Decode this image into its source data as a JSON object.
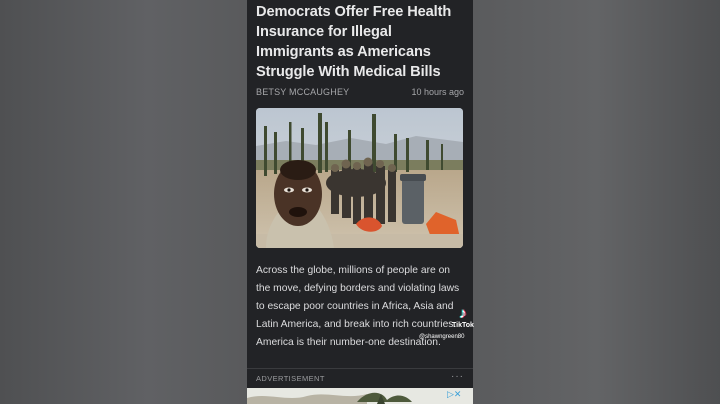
{
  "article": {
    "headline_lines": [
      "Democrats Offer Free Health",
      "Insurance for Illegal",
      "Immigrants as Americans",
      "Struggle With Medical Bills"
    ],
    "author": "BETSY MCCAUGHEY",
    "timestamp": "10 hours ago",
    "body_lines": [
      "Across the globe, millions of people are on",
      "the move, defying borders and violating laws",
      "to escape poor countries in Africa, Asia and",
      "Latin America, and break into rich countries.",
      "America is their number-one destination."
    ]
  },
  "ad": {
    "label": "ADVERTISEMENT",
    "more": "···",
    "choices": "▷✕"
  },
  "watermark": {
    "logo": "♪",
    "brand": "TikTok",
    "handle": "@shawngreen80"
  },
  "icons": [
    "more-icon",
    "ad-choices-icon",
    "tiktok-icon"
  ]
}
